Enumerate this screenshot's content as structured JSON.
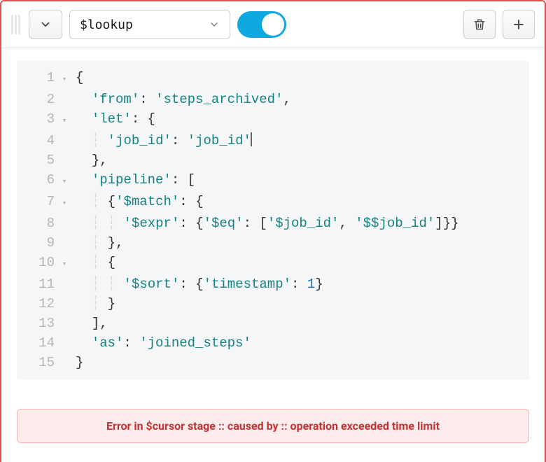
{
  "toolbar": {
    "stage_label": "$lookup",
    "toggle_on": true
  },
  "code": {
    "lines": [
      {
        "n": "1",
        "fold": true,
        "html": "<span class='tok-delim'>{</span>"
      },
      {
        "n": "2",
        "fold": false,
        "html": "  <span class='tok-key'>'from'</span><span class='tok-colon'>:</span> <span class='tok-str'>'steps_archived'</span><span class='tok-delim'>,</span>"
      },
      {
        "n": "3",
        "fold": true,
        "html": "  <span class='tok-key'>'let'</span><span class='tok-colon'>:</span> <span class='tok-delim'>{</span>"
      },
      {
        "n": "4",
        "fold": false,
        "html": "    <span class='tok-key'>'job_id'</span><span class='tok-colon'>:</span> <span class='tok-str'>'job_id'</span><span class='cursor'></span>"
      },
      {
        "n": "5",
        "fold": false,
        "html": "  <span class='tok-delim'>},</span>"
      },
      {
        "n": "6",
        "fold": true,
        "html": "  <span class='tok-key'>'pipeline'</span><span class='tok-colon'>:</span> <span class='tok-bracket'>[</span>"
      },
      {
        "n": "7",
        "fold": true,
        "html": "    <span class='tok-delim'>{</span><span class='tok-key'>'$match'</span><span class='tok-colon'>:</span> <span class='tok-delim'>{</span>"
      },
      {
        "n": "8",
        "fold": false,
        "html": "      <span class='tok-key'>'$expr'</span><span class='tok-colon'>:</span> <span class='tok-delim'>{</span><span class='tok-key'>'$eq'</span><span class='tok-colon'>:</span> <span class='tok-bracket'>[</span><span class='tok-str'>'$job_id'</span><span class='tok-delim'>,</span> <span class='tok-str'>'$$job_id'</span><span class='tok-bracket'>]</span><span class='tok-delim'>}}</span>"
      },
      {
        "n": "9",
        "fold": false,
        "html": "    <span class='tok-delim'>},</span>"
      },
      {
        "n": "10",
        "fold": true,
        "html": "    <span class='tok-delim'>{</span>"
      },
      {
        "n": "11",
        "fold": false,
        "html": "      <span class='tok-key'>'$sort'</span><span class='tok-colon'>:</span> <span class='tok-delim'>{</span><span class='tok-key'>'timestamp'</span><span class='tok-colon'>:</span> <span class='tok-num'>1</span><span class='tok-delim'>}</span>"
      },
      {
        "n": "12",
        "fold": false,
        "html": "    <span class='tok-delim'>}</span>"
      },
      {
        "n": "13",
        "fold": false,
        "html": "  <span class='tok-bracket'>]</span><span class='tok-delim'>,</span>"
      },
      {
        "n": "14",
        "fold": false,
        "html": "  <span class='tok-key'>'as'</span><span class='tok-colon'>:</span> <span class='tok-str'>'joined_steps'</span>"
      },
      {
        "n": "15",
        "fold": false,
        "html": "<span class='tok-delim'>}</span>"
      }
    ]
  },
  "error": {
    "message": "Error in $cursor stage :: caused by :: operation exceeded time limit"
  }
}
